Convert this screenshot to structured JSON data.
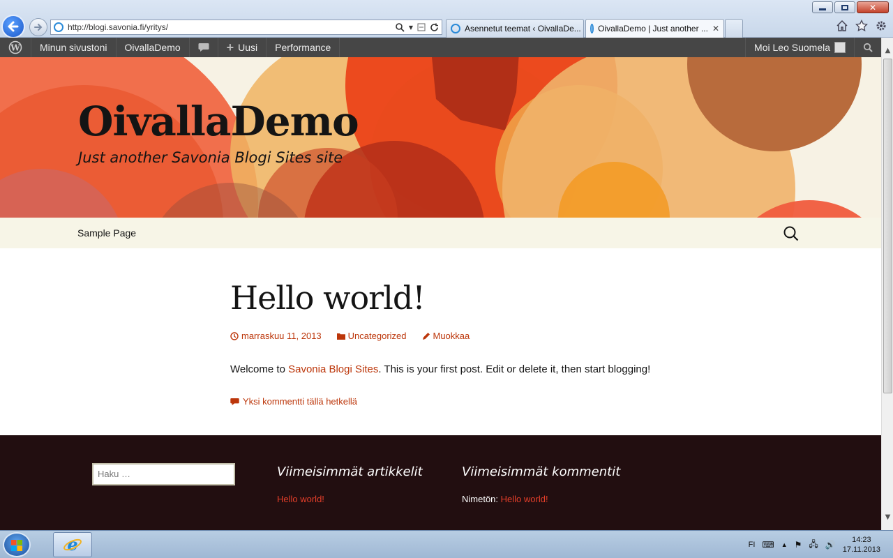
{
  "browser": {
    "address": "http://blogi.savonia.fi/yritys/",
    "tabs": [
      {
        "label": "Asennetut teemat ‹ OivallaDe..."
      },
      {
        "label": "OivallaDemo | Just another ..."
      }
    ]
  },
  "admin_bar": {
    "my_sites": "Minun sivustoni",
    "site": "OivallaDemo",
    "new": "Uusi",
    "performance": "Performance",
    "greeting": "Moi Leo Suomela"
  },
  "site": {
    "title": "OivallaDemo",
    "description": "Just another Savonia Blogi Sites site"
  },
  "nav": {
    "items": [
      {
        "label": "Sample Page"
      }
    ]
  },
  "post": {
    "title": "Hello world!",
    "date": "marraskuu 11, 2013",
    "category": "Uncategorized",
    "edit": "Muokkaa",
    "content_before": "Welcome to ",
    "content_link": "Savonia Blogi Sites",
    "content_after": ". This is your first post. Edit or delete it, then start blogging!",
    "comments": "Yksi kommentti tällä hetkellä"
  },
  "footer": {
    "search_placeholder": "Haku …",
    "recent_posts_title": "Viimeisimmät artikkelit",
    "recent_posts": [
      {
        "label": "Hello world!"
      }
    ],
    "recent_comments_title": "Viimeisimmät kommentit",
    "recent_comments": [
      {
        "author": "Nimetön:",
        "sep": " ",
        "post": "Hello world!"
      }
    ]
  },
  "taskbar": {
    "language": "FI",
    "time": "14:23",
    "date": "17.11.2013"
  },
  "colors": {
    "accent": "#bc360a",
    "footer_bg": "#220e10",
    "admin_bar": "#464646"
  }
}
